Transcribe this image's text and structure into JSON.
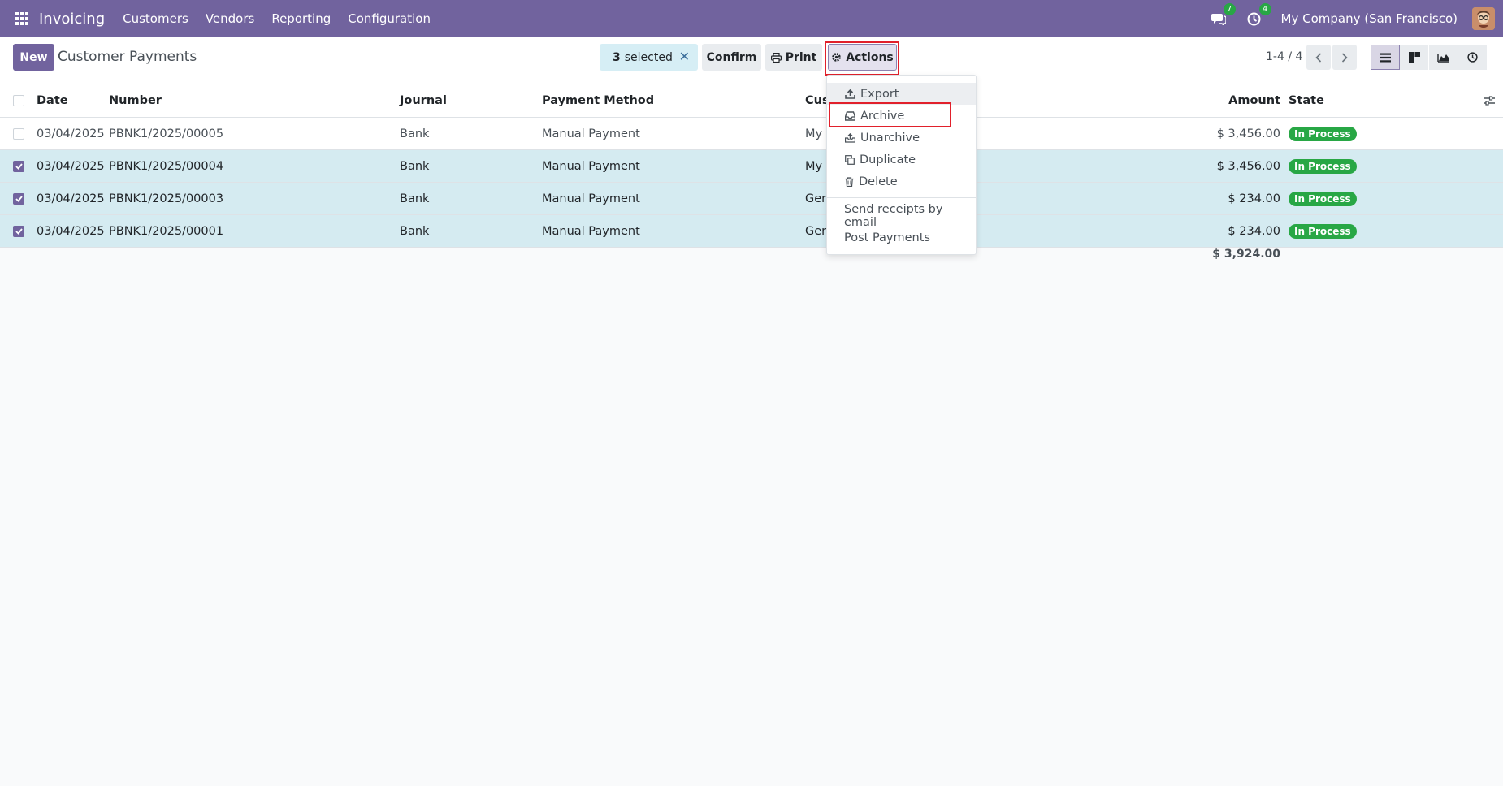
{
  "navbar": {
    "app_name": "Invoicing",
    "menu": [
      "Customers",
      "Vendors",
      "Reporting",
      "Configuration"
    ],
    "messages_count": "7",
    "activities_count": "4",
    "company": "My Company (San Francisco)"
  },
  "control": {
    "new_label": "New",
    "title": "Customer Payments",
    "selected_count": "3",
    "selected_label": "selected",
    "confirm_label": "Confirm",
    "print_label": "Print",
    "actions_label": "Actions",
    "pager": "1-4 / 4"
  },
  "actions_menu": {
    "items": [
      "Export",
      "Archive",
      "Unarchive",
      "Duplicate",
      "Delete"
    ],
    "extra": [
      "Send receipts by email",
      "Post Payments"
    ]
  },
  "table": {
    "headers": {
      "date": "Date",
      "number": "Number",
      "journal": "Journal",
      "payment_method": "Payment Method",
      "customer": "Customer",
      "amount": "Amount",
      "state": "State"
    },
    "rows": [
      {
        "date": "03/04/2025",
        "number": "PBNK1/2025/00005",
        "journal": "Bank",
        "payment_method": "Manual Payment",
        "customer": "My Company",
        "amount": "$ 3,456.00",
        "state": "In Process",
        "selected": false
      },
      {
        "date": "03/04/2025",
        "number": "PBNK1/2025/00004",
        "journal": "Bank",
        "payment_method": "Manual Payment",
        "customer": "My Company",
        "amount": "$ 3,456.00",
        "state": "In Process",
        "selected": true
      },
      {
        "date": "03/04/2025",
        "number": "PBNK1/2025/00003",
        "journal": "Bank",
        "payment_method": "Manual Payment",
        "customer": "Gemini Furniture",
        "amount": "$ 234.00",
        "state": "In Process",
        "selected": true
      },
      {
        "date": "03/04/2025",
        "number": "PBNK1/2025/00001",
        "journal": "Bank",
        "payment_method": "Manual Payment",
        "customer": "Gemini Furniture",
        "amount": "$ 234.00",
        "state": "In Process",
        "selected": true
      }
    ],
    "total": "$ 3,924.00"
  },
  "colors": {
    "brand": "#71639e",
    "success": "#28a745",
    "highlight": "#e1202b",
    "selected_row": "#d5ebf1"
  }
}
